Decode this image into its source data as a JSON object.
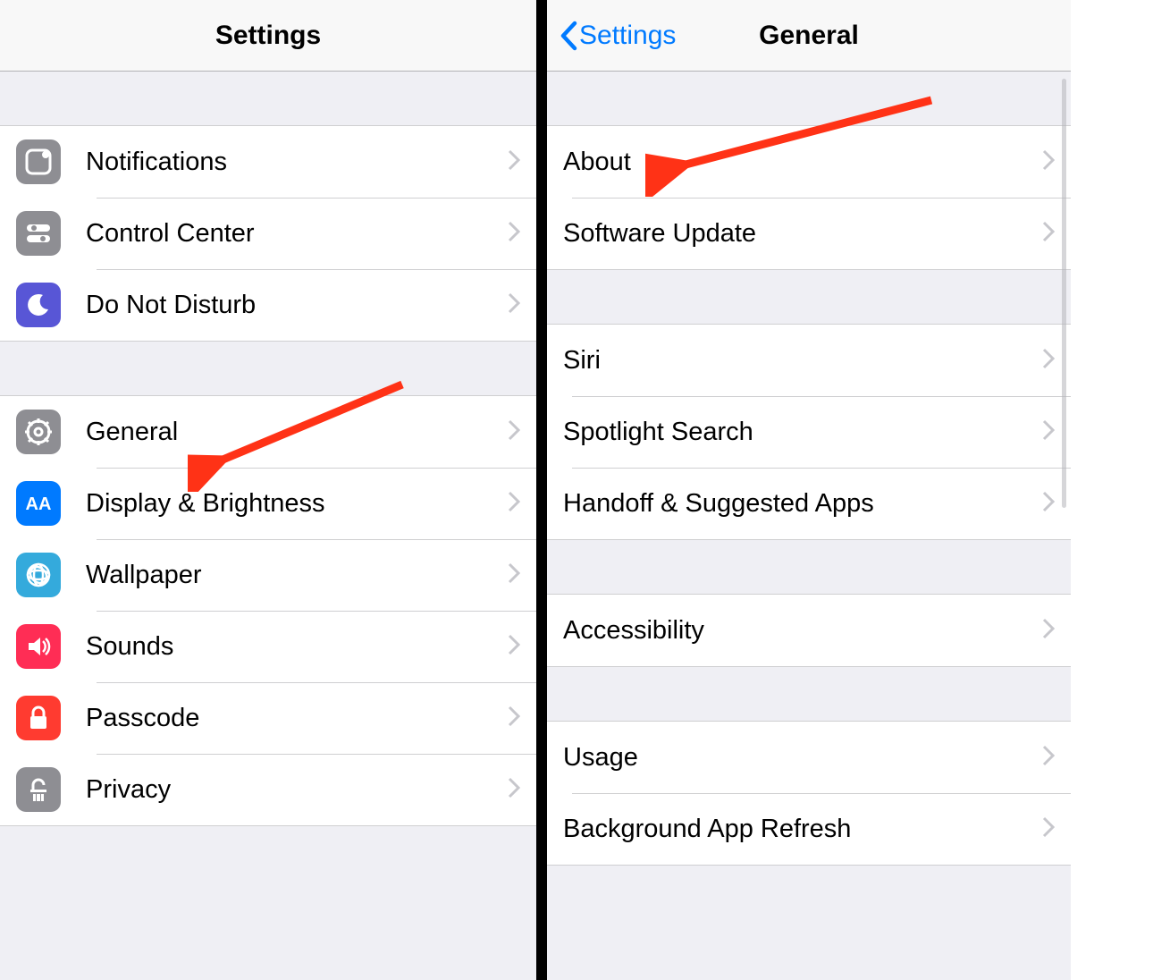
{
  "left": {
    "title": "Settings",
    "groups": [
      [
        {
          "key": "notifications",
          "label": "Notifications",
          "icon": "notifications-icon",
          "icon_class": "ic-gray"
        },
        {
          "key": "control-center",
          "label": "Control Center",
          "icon": "control-center-icon",
          "icon_class": "ic-gray"
        },
        {
          "key": "do-not-disturb",
          "label": "Do Not Disturb",
          "icon": "do-not-disturb-icon",
          "icon_class": "ic-purple"
        }
      ],
      [
        {
          "key": "general",
          "label": "General",
          "icon": "gear-icon",
          "icon_class": "ic-gray"
        },
        {
          "key": "display",
          "label": "Display & Brightness",
          "icon": "display-icon",
          "icon_class": "ic-blue"
        },
        {
          "key": "wallpaper",
          "label": "Wallpaper",
          "icon": "wallpaper-icon",
          "icon_class": "ic-teal"
        },
        {
          "key": "sounds",
          "label": "Sounds",
          "icon": "sounds-icon",
          "icon_class": "ic-pink"
        },
        {
          "key": "passcode",
          "label": "Passcode",
          "icon": "passcode-icon",
          "icon_class": "ic-red"
        },
        {
          "key": "privacy",
          "label": "Privacy",
          "icon": "privacy-icon",
          "icon_class": "ic-gray"
        }
      ]
    ]
  },
  "right": {
    "back_label": "Settings",
    "title": "General",
    "groups": [
      [
        {
          "key": "about",
          "label": "About"
        },
        {
          "key": "software-update",
          "label": "Software Update"
        }
      ],
      [
        {
          "key": "siri",
          "label": "Siri"
        },
        {
          "key": "spotlight",
          "label": "Spotlight Search"
        },
        {
          "key": "handoff",
          "label": "Handoff & Suggested Apps"
        }
      ],
      [
        {
          "key": "accessibility",
          "label": "Accessibility"
        }
      ],
      [
        {
          "key": "usage",
          "label": "Usage"
        },
        {
          "key": "bg-refresh",
          "label": "Background App Refresh"
        }
      ]
    ]
  },
  "colors": {
    "accent": "#007aff",
    "annotation": "#ff3216"
  }
}
